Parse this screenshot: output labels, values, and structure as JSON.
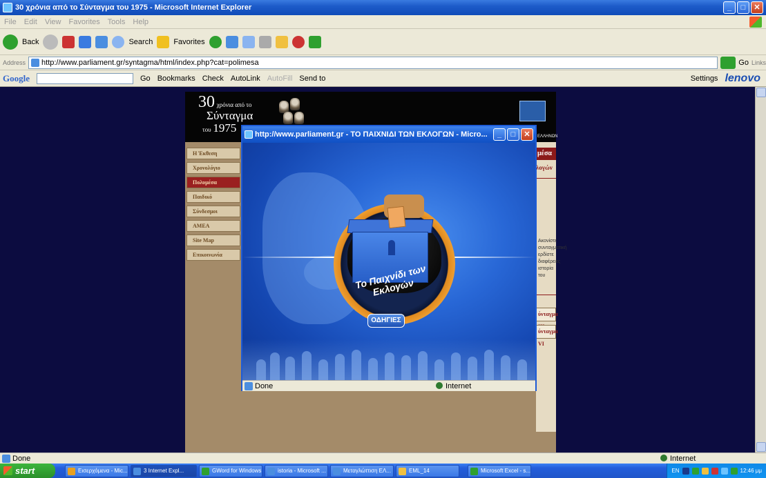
{
  "ie_window": {
    "title": "30 χρόνια από το Σύνταγμα του 1975 - Microsoft Internet Explorer",
    "menu": [
      "File",
      "Edit",
      "View",
      "Favorites",
      "Tools",
      "Help"
    ],
    "toolbar": {
      "back": "Back",
      "search": "Search",
      "favorites": "Favorites"
    },
    "address_label": "Address",
    "address": "http://www.parliament.gr/syntagma/html/index.php?cat=polimesa",
    "go": "Go",
    "links": "Links",
    "google_bar": {
      "logo": "Google",
      "go": "Go",
      "bookmarks": "Bookmarks",
      "check": "Check",
      "autolink": "AutoLink",
      "autofill": "AutoFill",
      "send_to": "Send to",
      "settings": "Settings"
    },
    "lenovo": "lenovo",
    "status": "Done",
    "zone": "Internet"
  },
  "site": {
    "title_big": "30",
    "title_small": "χρόνια από το",
    "title_mid": "Σύνταγμα",
    "title_tou": "του",
    "title_year": "1975",
    "parliament_text": "ΕΛΛΗΝΩΝ",
    "menu": [
      {
        "label": "Η Έκθεση",
        "active": false
      },
      {
        "label": "Χρονολόγιο",
        "active": false
      },
      {
        "label": "Πολυμέσα",
        "active": true
      },
      {
        "label": "Παιδικό",
        "active": false
      },
      {
        "label": "Σύνδεσμοι",
        "active": false
      },
      {
        "label": "ΑΜΕΑ",
        "active": false
      },
      {
        "label": "Site Map",
        "active": false
      },
      {
        "label": "Επικοινωνία",
        "active": false
      }
    ],
    "right_head": "μέσα",
    "right_sub": "λογών",
    "right_para": "Ακονίστε συνταγματική ερδίστε διαφέρειες ιστορία του",
    "right_btn1": "ύνταγμα III",
    "right_btn2": "ύνταγμα VI"
  },
  "popup": {
    "title": "http://www.parliament.gr - ΤΟ ΠΑΙΧΝΙΔΙ ΤΩΝ ΕΚΛΟΓΩΝ - Micro...",
    "game_title": "Το Παιχνίδι των Εκλογών",
    "help_button": "ΟΔΗΓΙΕΣ",
    "status": "Done",
    "zone": "Internet"
  },
  "taskbar": {
    "start": "start",
    "tasks": [
      {
        "label": "Εισερχόμενα - Mic...",
        "color": "#e8a020"
      },
      {
        "label": "3 Internet Expl...",
        "color": "#4b8ee0",
        "active": true
      },
      {
        "label": "GWord for Windows",
        "color": "#2fa02f"
      },
      {
        "label": "istoria - Microsoft ...",
        "color": "#4b8ee0"
      },
      {
        "label": "Μεταγλώττιση ΕΛ...",
        "color": "#4b8ee0"
      },
      {
        "label": "EML_14",
        "color": "#f0c040"
      },
      {
        "label": "Microsoft Excel - s...",
        "color": "#2fa02f"
      }
    ],
    "lang": "EN",
    "clock": "12:46 μμ"
  }
}
